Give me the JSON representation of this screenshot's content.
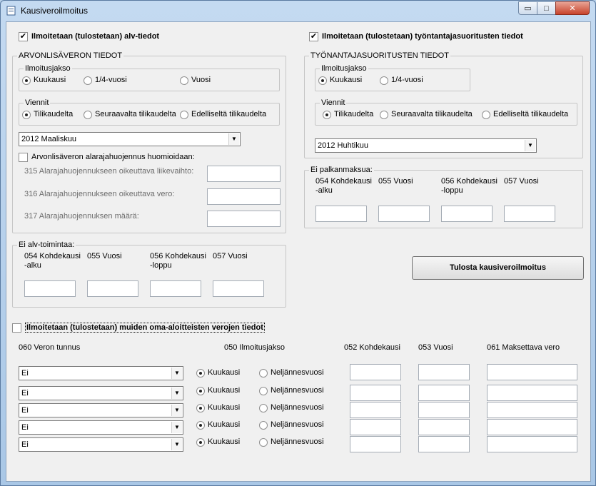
{
  "window": {
    "title": "Kausiveroilmoitus",
    "minimize": "▭",
    "maximize": "□",
    "close": "✕"
  },
  "alv_check": {
    "label": "Ilmoitetaan (tulostetaan) alv-tiedot",
    "checked": true
  },
  "alv": {
    "group_title": "ARVONLISÄVERON TIEDOT",
    "period_title": "Ilmoitusjakso",
    "periods": [
      "Kuukausi",
      "1/4-vuosi",
      "Vuosi"
    ],
    "period_selected": 0,
    "exports_title": "Viennit",
    "exports": [
      "Tilikaudelta",
      "Seuraavalta tilikaudelta",
      "Edelliseltä tilikaudelta"
    ],
    "exports_selected": 0,
    "month": "2012 Maaliskuu",
    "threshold_check": "Arvonlisäveron alarajahuojennus huomioidaan:",
    "field_315": "315 Alarajahuojennukseen oikeuttava liikevaihto:",
    "field_316": "316 Alarajahuojennukseen oikeuttava vero:",
    "field_317": "317 Alarajahuojennuksen määrä:"
  },
  "no_alv": {
    "title": "Ei alv-toimintaa:",
    "c054": "054 Kohdekausi\n-alku",
    "c055": "055 Vuosi",
    "c056": "056 Kohdekausi\n-loppu",
    "c057": "057 Vuosi"
  },
  "employer_check": {
    "label": "Ilmoitetaan (tulostetaan) työntantajasuoritusten tiedot",
    "checked": true
  },
  "employer": {
    "group_title": "TYÖNANTAJASUORITUSTEN TIEDOT",
    "period_title": "Ilmoitusjakso",
    "periods": [
      "Kuukausi",
      "1/4-vuosi"
    ],
    "exports_title": "Viennit",
    "exports": [
      "Tilikaudelta",
      "Seuraavalta tilikaudelta",
      "Edelliseltä tilikaudelta"
    ],
    "month": "2012 Huhtikuu"
  },
  "no_salary": {
    "title": "Ei palkanmaksua:",
    "c054": "054 Kohdekausi\n-alku",
    "c055": "055 Vuosi",
    "c056": "056 Kohdekausi\n-loppu",
    "c057": "057 Vuosi"
  },
  "print_button": "Tulosta kausiveroilmoitus",
  "other_check": {
    "label": "Ilmoitetaan (tulostetaan) muiden oma-aloitteisten verojen tiedot",
    "checked": false
  },
  "other": {
    "col_tax": "060 Veron tunnus",
    "col_period": "050 Ilmoitusjakso",
    "col_052": "052 Kohdekausi",
    "col_053": "053 Vuosi",
    "col_061": "061 Maksettava vero",
    "rows": [
      {
        "tax": "Ei",
        "opt1": "Kuukausi",
        "opt2": "Neljännesvuosi"
      },
      {
        "tax": "Ei",
        "opt1": "Kuukausi",
        "opt2": "Neljännesvuosi"
      },
      {
        "tax": "Ei",
        "opt1": "Kuukausi",
        "opt2": "Neljännesvuosi"
      },
      {
        "tax": "Ei",
        "opt1": "Kuukausi",
        "opt2": "Neljännesvuosi"
      },
      {
        "tax": "Ei",
        "opt1": "Kuukausi",
        "opt2": "Neljännesvuosi"
      }
    ]
  },
  "icons": {
    "dropdown": "▼",
    "check": "✔"
  }
}
